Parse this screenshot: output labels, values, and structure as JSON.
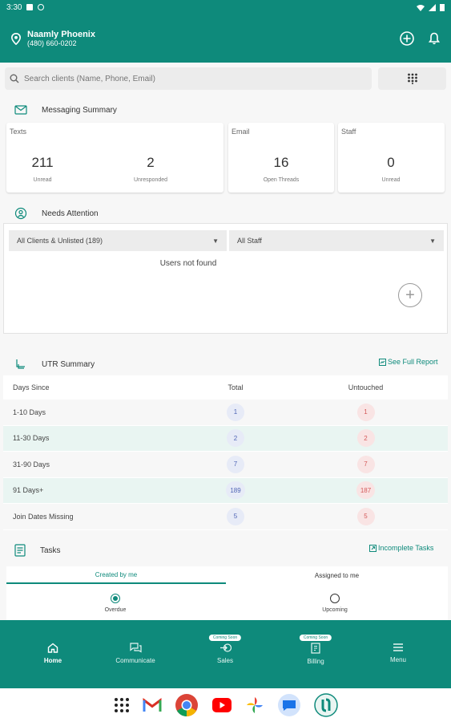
{
  "status_bar": {
    "time": "3:30"
  },
  "header": {
    "location_name": "Naamly Phoenix",
    "phone": "(480) 660-0202"
  },
  "search": {
    "placeholder": "Search clients (Name, Phone, Email)"
  },
  "messaging": {
    "title": "Messaging Summary",
    "texts": {
      "label": "Texts",
      "unread": "211",
      "unread_label": "Unread",
      "unresponded": "2",
      "unresponded_label": "Unresponded"
    },
    "email": {
      "label": "Email",
      "open": "16",
      "open_label": "Open Threads"
    },
    "staff": {
      "label": "Staff",
      "unread": "0",
      "unread_label": "Unread"
    }
  },
  "attention": {
    "title": "Needs Attention",
    "client_filter": "All Clients & Unlisted (189)",
    "staff_filter": "All Staff",
    "empty_text": "Users not found"
  },
  "utr": {
    "title": "UTR Summary",
    "report_link": "See Full Report",
    "headers": [
      "Days Since",
      "Total",
      "Untouched"
    ],
    "rows": [
      {
        "label": "1-10 Days",
        "total": "1",
        "untouched": "1"
      },
      {
        "label": "11-30 Days",
        "total": "2",
        "untouched": "2"
      },
      {
        "label": "31-90 Days",
        "total": "7",
        "untouched": "7"
      },
      {
        "label": "91 Days+",
        "total": "189",
        "untouched": "187"
      },
      {
        "label": "Join Dates Missing",
        "total": "5",
        "untouched": "5"
      }
    ]
  },
  "tasks": {
    "title": "Tasks",
    "link": "Incomplete Tasks",
    "tabs": [
      "Created by me",
      "Assigned to me"
    ],
    "filters": [
      "Overdue",
      "Upcoming"
    ]
  },
  "nav": {
    "items": [
      "Home",
      "Communicate",
      "Sales",
      "Billing",
      "Menu"
    ],
    "coming_soon": "Coming Soon"
  },
  "colors": {
    "brand": "#0e8a7b"
  }
}
